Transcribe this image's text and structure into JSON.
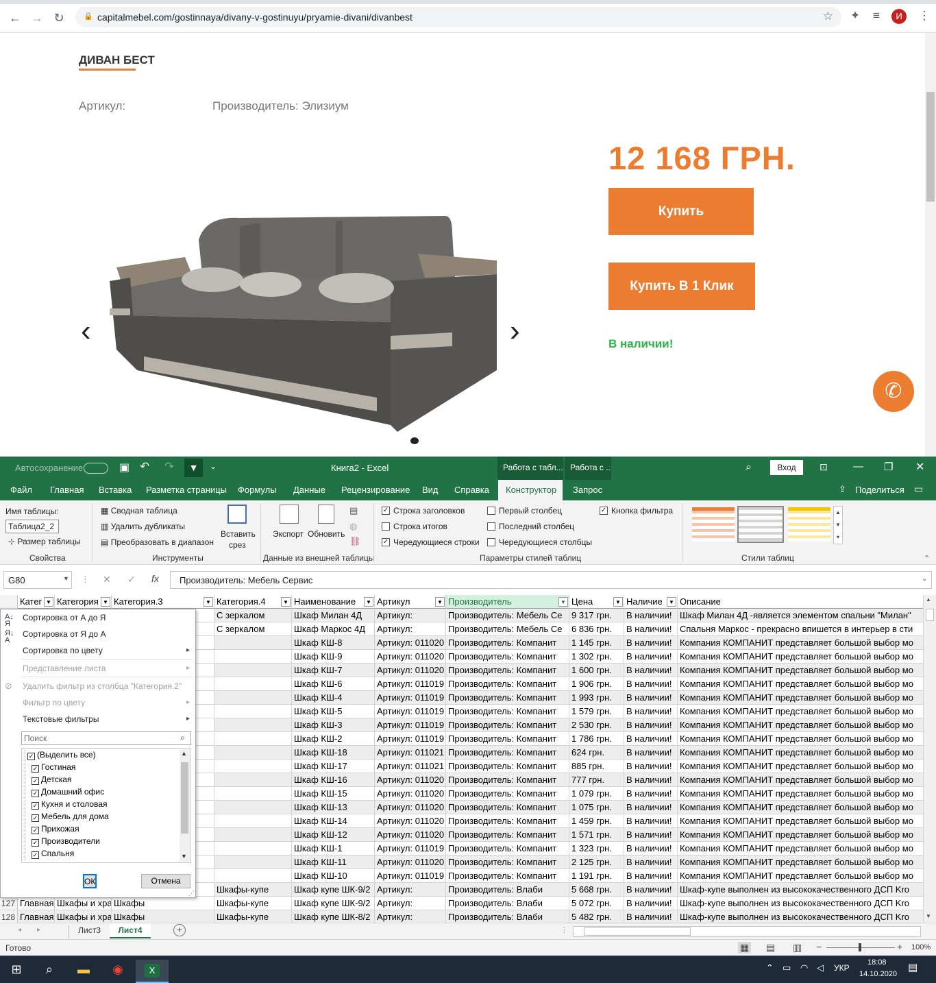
{
  "browser": {
    "url": "capitalmebel.com/gostinnaya/divany-v-gostinuyu/pryamie-divani/divanbest",
    "avatar_letter": "И",
    "icons": [
      "back-icon",
      "forward-icon",
      "reload-icon",
      "lock-icon",
      "star-icon",
      "extensions-icon",
      "media-icon"
    ]
  },
  "product": {
    "title": "ДИВАН БЕСТ",
    "sku_label": "Артикул:",
    "maker": "Производитель: Элизиум",
    "price": "12 168 ГРН.",
    "buy_label": "Купить",
    "buy_one_click_label": "Купить В 1 Клик",
    "stock": "В наличии!",
    "accent_color": "#ec7c30",
    "stock_color": "#28b446"
  },
  "excel": {
    "title": "Книга2  -  Excel",
    "autosave": "Автосохранение",
    "context_tab1": "Работа с табл...",
    "context_tab2": "Работа с ...",
    "login": "Вход",
    "tabs": [
      "Файл",
      "Главная",
      "Вставка",
      "Разметка страницы",
      "Формулы",
      "Данные",
      "Рецензирование",
      "Вид",
      "Справка",
      "Конструктор",
      "Запрос"
    ],
    "active_tab": "Конструктор",
    "share": "Поделиться",
    "ribbon": {
      "table_name_label": "Имя таблицы:",
      "table_name": "Таблица2_2",
      "resize": "Размер таблицы",
      "group_props": "Свойства",
      "pivot": "Сводная таблица",
      "remove_dupes": "Удалить дубликаты",
      "convert": "Преобразовать в диапазон",
      "insert_slicer": "Вставить",
      "insert_slicer2": "срез",
      "group_tools": "Инструменты",
      "export": "Экспорт",
      "refresh": "Обновить",
      "group_external": "Данные из внешней таблицы",
      "header_row": "Строка заголовков",
      "total_row": "Строка итогов",
      "banded_rows": "Чередующиеся строки",
      "first_col": "Первый столбец",
      "last_col": "Последний столбец",
      "banded_cols": "Чередующиеся столбцы",
      "filter_btn": "Кнопка фильтра",
      "group_style_opts": "Параметры стилей таблиц",
      "group_styles": "Стили таблиц"
    },
    "name_box": "G80",
    "formula": "Производитель: Мебель Сервис",
    "columns": [
      "Катег",
      "Категория",
      "Категория.3",
      "Категория.4",
      "Наименование",
      "Артикул",
      "Производитель",
      "Цена",
      "Наличие",
      "Описание"
    ],
    "rows": [
      [
        "",
        "",
        "",
        "С зеркалом",
        "Шкаф Милан 4Д",
        "Артикул:",
        "Производитель: Мебель Се",
        "9 317 грн.",
        "В наличии!",
        "Шкаф Милан 4Д -является элементом спальни \"Милан\""
      ],
      [
        "",
        "",
        "",
        "С зеркалом",
        "Шкаф Маркос 4Д",
        "Артикул:",
        "Производитель: Мебель Се",
        "6 836 грн.",
        "В наличии!",
        "Спальня Маркос - прекрасно впишется в интерьер в сти"
      ],
      [
        "",
        "",
        "",
        "",
        "Шкаф КШ-8",
        "Артикул: 011020",
        "Производитель: Компанит",
        "1 145 грн.",
        "В наличии!",
        "Компания КОМПАНИТ представляет большой выбор мо"
      ],
      [
        "",
        "",
        "",
        "",
        "Шкаф КШ-9",
        "Артикул: 011020",
        "Производитель: Компанит",
        "1 302 грн.",
        "В наличии!",
        "Компания КОМПАНИТ представляет большой выбор мо"
      ],
      [
        "",
        "",
        "",
        "",
        "Шкаф КШ-7",
        "Артикул: 011020",
        "Производитель: Компанит",
        "1 600 грн.",
        "В наличии!",
        "Компания КОМПАНИТ представляет большой выбор мо"
      ],
      [
        "",
        "",
        "",
        "",
        "Шкаф КШ-6",
        "Артикул: 011019",
        "Производитель: Компанит",
        "1 906 грн.",
        "В наличии!",
        "Компания КОМПАНИТ представляет большой выбор мо"
      ],
      [
        "",
        "",
        "",
        "",
        "Шкаф КШ-4",
        "Артикул: 011019",
        "Производитель: Компанит",
        "1 993 грн.",
        "В наличии!",
        "Компания КОМПАНИТ представляет большой выбор мо"
      ],
      [
        "",
        "",
        "",
        "",
        "Шкаф КШ-5",
        "Артикул: 011019",
        "Производитель: Компанит",
        "1 579 грн.",
        "В наличии!",
        "Компания КОМПАНИТ представляет большой выбор мо"
      ],
      [
        "",
        "",
        "",
        "",
        "Шкаф КШ-3",
        "Артикул: 011019",
        "Производитель: Компанит",
        "2 530 грн.",
        "В наличии!",
        "Компания КОМПАНИТ представляет большой выбор мо"
      ],
      [
        "",
        "",
        "",
        "",
        "Шкаф КШ-2",
        "Артикул: 011019",
        "Производитель: Компанит",
        "1 786 грн.",
        "В наличии!",
        "Компания КОМПАНИТ представляет большой выбор мо"
      ],
      [
        "",
        "",
        "",
        "",
        "Шкаф КШ-18",
        "Артикул: 011021",
        "Производитель: Компанит",
        "624 грн.",
        "В наличии!",
        "Компания КОМПАНИТ представляет большой выбор мо"
      ],
      [
        "",
        "",
        "",
        "",
        "Шкаф КШ-17",
        "Артикул: 011021",
        "Производитель: Компанит",
        "885 грн.",
        "В наличии!",
        "Компания КОМПАНИТ представляет большой выбор мо"
      ],
      [
        "",
        "",
        "",
        "",
        "Шкаф КШ-16",
        "Артикул: 011020",
        "Производитель: Компанит",
        "777 грн.",
        "В наличии!",
        "Компания КОМПАНИТ представляет большой выбор мо"
      ],
      [
        "",
        "",
        "",
        "",
        "Шкаф КШ-15",
        "Артикул: 011020",
        "Производитель: Компанит",
        "1 079 грн.",
        "В наличии!",
        "Компания КОМПАНИТ представляет большой выбор мо"
      ],
      [
        "",
        "",
        "",
        "",
        "Шкаф КШ-13",
        "Артикул: 011020",
        "Производитель: Компанит",
        "1 075 грн.",
        "В наличии!",
        "Компания КОМПАНИТ представляет большой выбор мо"
      ],
      [
        "",
        "",
        "",
        "",
        "Шкаф КШ-14",
        "Артикул: 011020",
        "Производитель: Компанит",
        "1 459 грн.",
        "В наличии!",
        "Компания КОМПАНИТ представляет большой выбор мо"
      ],
      [
        "",
        "",
        "",
        "",
        "Шкаф КШ-12",
        "Артикул: 011020",
        "Производитель: Компанит",
        "1 571 грн.",
        "В наличии!",
        "Компания КОМПАНИТ представляет большой выбор мо"
      ],
      [
        "",
        "",
        "",
        "",
        "Шкаф КШ-1",
        "Артикул: 011019",
        "Производитель: Компанит",
        "1 323 грн.",
        "В наличии!",
        "Компания КОМПАНИТ представляет большой выбор мо"
      ],
      [
        "",
        "",
        "",
        "",
        "Шкаф КШ-11",
        "Артикул: 011020",
        "Производитель: Компанит",
        "2 125 грн.",
        "В наличии!",
        "Компания КОМПАНИТ представляет большой выбор мо"
      ],
      [
        "",
        "",
        "",
        "",
        "Шкаф КШ-10",
        "Артикул: 011019",
        "Производитель: Компанит",
        "1 191 грн.",
        "В наличии!",
        "Компания КОМПАНИТ представляет большой выбор мо"
      ],
      [
        "",
        "",
        "",
        "Шкафы-купе",
        "Шкаф купе ШК-9/2",
        "Артикул:",
        "Производитель: Влаби",
        "5 668 грн.",
        "В наличии!",
        "Шкаф-купе выполнен из высококачественного ДСП Kro"
      ],
      [
        "127",
        "Главная",
        "Шкафы и хра",
        "Шкафы",
        "Шкафы-купе",
        "Шкаф купе ШК-9/2",
        "Артикул:",
        "Производитель: Влаби",
        "5 072 грн.",
        "В наличии!",
        "Шкаф-купе выполнен из высококачественного ДСП Kro"
      ],
      [
        "128",
        "Главная",
        "Шкафы и хра",
        "Шкафы",
        "Шкафы-купе",
        "Шкаф купе ШК-8/2",
        "Артикул:",
        "Производитель: Влаби",
        "5 482 грн.",
        "В наличии!",
        "Шкаф-купе выполнен из высококачественного ДСП Kro"
      ]
    ],
    "filter_menu": {
      "sort_az": "Сортировка от А до Я",
      "sort_za": "Сортировка от Я до А",
      "sort_color": "Сортировка по цвету",
      "sheet_view": "Представление листа",
      "clear_filter": "Удалить фильтр из столбца \"Категория.2\"",
      "filter_color": "Фильтр по цвету",
      "text_filters": "Текстовые фильтры",
      "search_placeholder": "Поиск",
      "items": [
        "(Выделить все)",
        "Гостиная",
        "Детская",
        "Домашний офис",
        "Кухня и столовая",
        "Мебель для дома",
        "Прихожая",
        "Производители",
        "Спальня"
      ],
      "ok": "ОК",
      "cancel": "Отмена"
    },
    "sheets": [
      "Лист3",
      "Лист4"
    ],
    "active_sheet": "Лист4",
    "status": "Готово",
    "zoom": "100%"
  },
  "taskbar": {
    "lang": "УКР",
    "time": "18:08",
    "date": "14.10.2020"
  }
}
